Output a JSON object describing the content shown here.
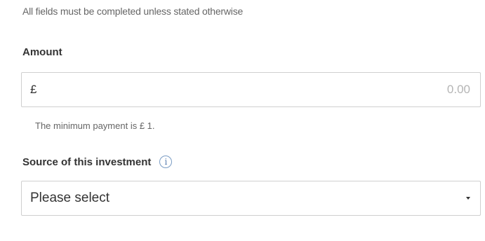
{
  "form": {
    "notice": "All fields must be completed unless stated otherwise",
    "amount": {
      "label": "Amount",
      "currency_symbol": "£",
      "placeholder": "0.00",
      "value": "",
      "hint": "The minimum payment is £ 1."
    },
    "source": {
      "label": "Source of this investment",
      "info_icon": "info-icon",
      "selected_value": "Please select",
      "dropdown_icon": "caret-down-icon"
    }
  },
  "colors": {
    "border": "#cfcfcf",
    "label_text": "#333333",
    "muted_text": "#666666",
    "placeholder_text": "#b5b5b5",
    "info_icon": "#5a7fb0"
  }
}
